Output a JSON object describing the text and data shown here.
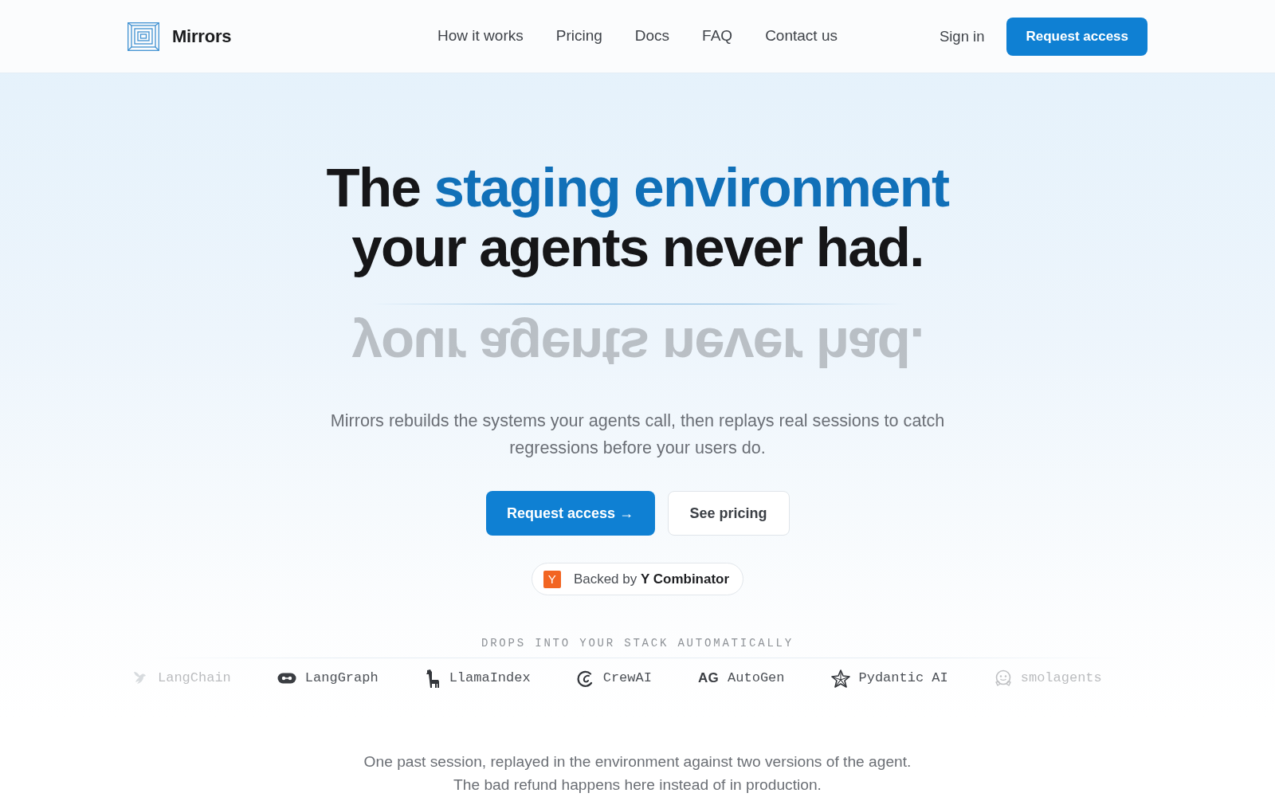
{
  "header": {
    "brand": "Mirrors",
    "nav": [
      {
        "label": "How it works"
      },
      {
        "label": "Pricing"
      },
      {
        "label": "Docs"
      },
      {
        "label": "FAQ"
      },
      {
        "label": "Contact us"
      }
    ],
    "sign_in": "Sign in",
    "cta": "Request access"
  },
  "hero": {
    "title_lines": [
      [
        {
          "text": "The ",
          "highlight": false
        },
        {
          "text": "staging environment",
          "highlight": true
        }
      ],
      [
        {
          "text": "your agents never had.",
          "highlight": false
        }
      ]
    ],
    "reflection": true,
    "subtitle": "Mirrors rebuilds the systems your agents call, then replays real sessions to catch regressions before your users do.",
    "primary_button": "Request access →",
    "secondary_button": "See pricing",
    "backer": {
      "logo_letter": "Y",
      "text": "Backed by **Y Combinator**"
    }
  },
  "integrations": {
    "heading": "DROPS INTO YOUR STACK AUTOMATICALLY",
    "items": [
      {
        "name": "LangChain",
        "kind": "icon",
        "faded": true
      },
      {
        "name": "LangGraph",
        "kind": "icon",
        "faded": false
      },
      {
        "name": "LlamaIndex",
        "kind": "icon",
        "faded": false
      },
      {
        "name": "CrewAI",
        "kind": "icon",
        "faded": false
      },
      {
        "name": "AutoGen",
        "kind": "monogram",
        "monogram": "AG",
        "faded": false
      },
      {
        "name": "Pydantic AI",
        "kind": "icon",
        "faded": false
      },
      {
        "name": "smolagents",
        "kind": "icon",
        "faded": true
      }
    ]
  },
  "demo": {
    "caption_lines": [
      "One past session, replayed in the environment against two versions of the agent.",
      "The bad refund happens here instead of in production."
    ]
  }
}
